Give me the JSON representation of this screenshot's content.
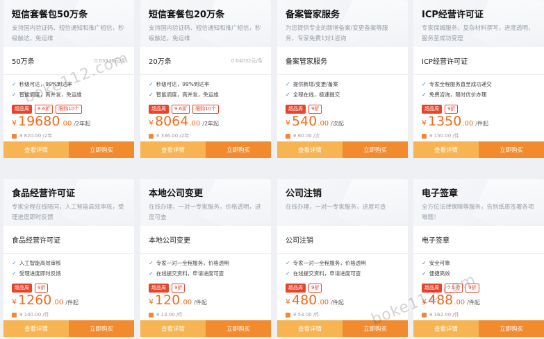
{
  "cards": [
    {
      "title": "短信套餐包50万条",
      "desc": "支持国内验证码、短信通知和推广短信，秒级触达，免运维",
      "spec": "50万条",
      "unit": "0.03936元/条",
      "features": [
        "秒级可达，99%到达率",
        "智能调度，高并发，免运维"
      ],
      "tags": [
        "超品周",
        "9.6折",
        "限购10个"
      ],
      "price": "19680",
      "cents": ".00",
      "suffix": "/2年起",
      "orig": "¥ 820.00 /2年"
    },
    {
      "title": "短信套餐包20万条",
      "desc": "支持国内验证码、短信通知和推广短信，秒级触达，免运维",
      "spec": "20万条",
      "unit": "0.04032元/条",
      "features": [
        "秒级可达，99%到达率",
        "智能调度，高并发，免运维"
      ],
      "tags": [
        "超品周",
        "9.6折",
        "限购10个"
      ],
      "price": "8064",
      "cents": ".00",
      "suffix": "/2年起",
      "orig": "¥ 336.00 /2年"
    },
    {
      "title": "备案管家服务",
      "desc": "为您提供专业的新增备案/变更备案等服务，专家免费1对1咨询",
      "spec": "备案管家服务",
      "unit": "",
      "features": [
        "提供新增/变更/备案",
        "全程在线，极速提交"
      ],
      "tags": [
        "超品周",
        "9折"
      ],
      "price": "540",
      "cents": ".00",
      "suffix": "/次起",
      "orig": "¥ 60.00 /次"
    },
    {
      "title": "ICP经营许可证",
      "desc": "专家保姆服务，复杂材料撰写，进度透明，服务至成功受理",
      "spec": "ICP经营许可证",
      "unit": "",
      "features": [
        "专家全程服务直至成功递交",
        "免费咨询，限时优价办理"
      ],
      "tags": [
        "超品周",
        "9折"
      ],
      "price": "1350",
      "cents": ".00",
      "suffix": "/件起",
      "orig": "¥ 150.00 /件"
    },
    {
      "title": "食品经营许可证",
      "desc": "专家全程在线陪同，人工智能高效审核，受理进度即时反馈",
      "spec": "食品经营许可证",
      "unit": "",
      "features": [
        "人工智能高效审核",
        "受理进度即时反馈"
      ],
      "tags": [
        "超品周",
        "9折"
      ],
      "price": "1260",
      "cents": ".00",
      "suffix": "/件起",
      "orig": "¥ 140.00 /件"
    },
    {
      "title": "本地公司变更",
      "desc": "在线办理，一对一专家服务，价格透明，进度可查",
      "spec": "本地公司变更",
      "unit": "",
      "features": [
        "专家一对一全程服务，价格透明",
        "在线提交资料，申请进度可查"
      ],
      "tags": [
        "超品周",
        "9折"
      ],
      "price": "120",
      "cents": ".00",
      "suffix": "/件起",
      "orig": "¥ 13.00 /件"
    },
    {
      "title": "公司注销",
      "desc": "在线办理，一对一专家服务，进度可查",
      "spec": "公司注销",
      "unit": "",
      "features": [
        "专家一对一全程服务，价格透明",
        "在线提交资料，申请进度可查"
      ],
      "tags": [
        "超品周",
        "9折"
      ],
      "price": "480",
      "cents": ".00",
      "suffix": "/件起",
      "orig": "¥ 53.00 /件"
    },
    {
      "title": "电子签章",
      "desc": "全方位法律保障等服务，告别纸质签署各项难题！",
      "spec": "电子签章",
      "unit": "",
      "features": [
        "安全可靠",
        "便捷高效"
      ],
      "tags": [
        "超品周",
        "7.5折",
        "9折"
      ],
      "price": "488",
      "cents": ".00",
      "suffix": "/件起",
      "orig": "¥ 162.00 /件"
    }
  ],
  "buttons": {
    "detail": "查看详情",
    "buy": "立即购买"
  },
  "watermark": "boke112.com",
  "colors": {
    "accent": "#f26a1b",
    "detail_btn": "#f7b452",
    "buy_btn": "#f28a2e",
    "tag": "#e8442c"
  }
}
